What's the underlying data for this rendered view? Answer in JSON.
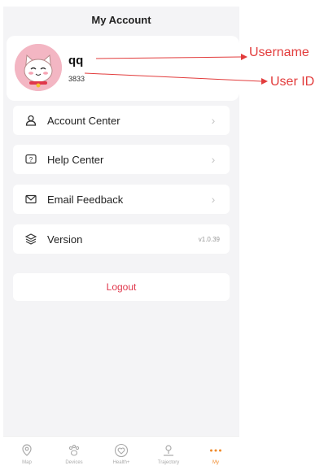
{
  "header": {
    "title": "My Account"
  },
  "profile": {
    "username": "qq",
    "user_id": "3833"
  },
  "menu": [
    {
      "label": "Account Center",
      "icon": "person-icon"
    },
    {
      "label": "Help Center",
      "icon": "help-icon"
    },
    {
      "label": "Email Feedback",
      "icon": "mail-icon"
    },
    {
      "label": "Version",
      "icon": "layers-icon",
      "value": "v1.0.39"
    }
  ],
  "logout": {
    "label": "Logout"
  },
  "tabbar": [
    {
      "label": "Map",
      "icon": "map-pin-icon"
    },
    {
      "label": "Devices",
      "icon": "paw-icon"
    },
    {
      "label": "Health+",
      "icon": "heart-icon"
    },
    {
      "label": "Trajectory",
      "icon": "location-icon"
    },
    {
      "label": "My",
      "icon": "more-dots-icon",
      "active": true
    }
  ],
  "annotations": {
    "username": "Username",
    "user_id": "User ID"
  },
  "colors": {
    "accent": "#f08a2b",
    "danger": "#e0364b",
    "annotation": "#e23c3c",
    "avatar_bg": "#f3b6c3"
  }
}
